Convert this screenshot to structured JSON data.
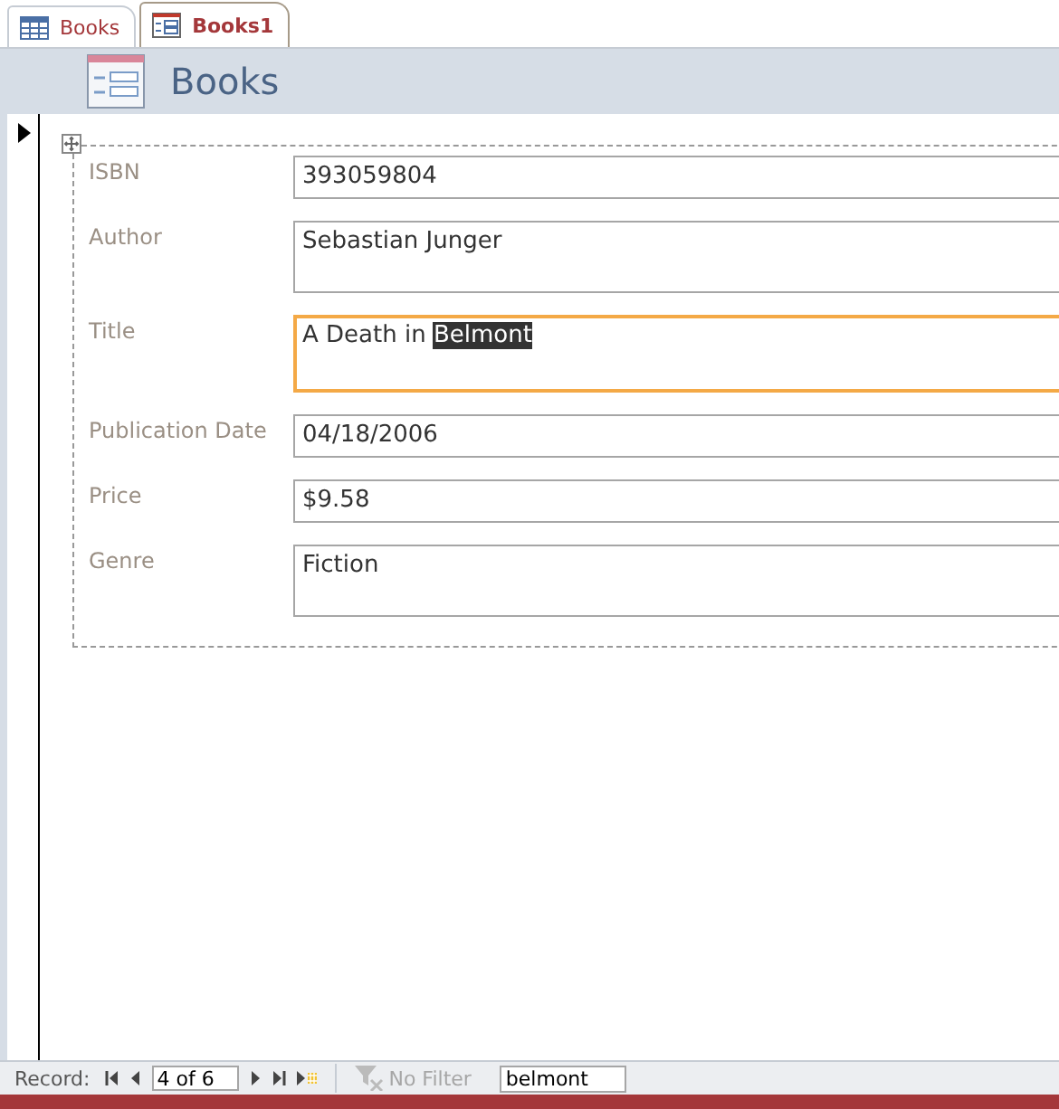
{
  "tabs": [
    {
      "label": "Books",
      "kind": "table",
      "selected": false
    },
    {
      "label": "Books1",
      "kind": "form",
      "selected": true
    }
  ],
  "header": {
    "title": "Books"
  },
  "fields": [
    {
      "label": "ISBN",
      "value": "393059804",
      "kind": "single",
      "focused": false
    },
    {
      "label": "Author",
      "value": "Sebastian Junger",
      "kind": "multi",
      "focused": false
    },
    {
      "label": "Title",
      "value": "A Death in ",
      "selected_text": "Belmont",
      "kind": "multi",
      "focused": true
    },
    {
      "label": "Publication Date",
      "value": "04/18/2006",
      "kind": "single",
      "focused": false
    },
    {
      "label": "Price",
      "value": "$9.58",
      "kind": "single",
      "focused": false
    },
    {
      "label": "Genre",
      "value": "Fiction",
      "kind": "multi",
      "focused": false
    }
  ],
  "navigation": {
    "label": "Record:",
    "position": "4 of 6",
    "filter": "No Filter",
    "filter_disabled": true,
    "search": "belmont"
  }
}
